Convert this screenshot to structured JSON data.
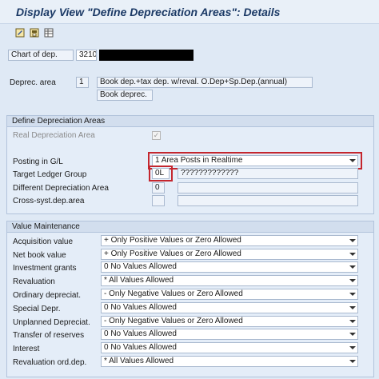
{
  "title": "Display View \"Define Depreciation Areas\": Details",
  "toolbar": {
    "icons": [
      "display-change-icon",
      "save-icon",
      "table-view-icon"
    ]
  },
  "header": {
    "chart_label": "Chart of dep.",
    "chart_value": "3210",
    "area_label": "Deprec. area",
    "area_value": "1",
    "area_description": "Book dep.+tax dep. w/reval. O.Dep+Sp.Dep.(annual)",
    "area_short": "Book deprec."
  },
  "define_areas": {
    "heading": "Define Depreciation Areas",
    "real_area_label": "Real Depreciation Area",
    "real_area_checked": true,
    "posting_label": "Posting in G/L",
    "posting_value": "1 Area Posts in Realtime",
    "target_label": "Target Ledger Group",
    "target_value": "0L",
    "target_desc": "?????????????",
    "diff_label": "Different Depreciation Area",
    "diff_value": "0",
    "cross_label": "Cross-syst.dep.area",
    "cross_value": ""
  },
  "value_maintenance": {
    "heading": "Value Maintenance",
    "rows": [
      {
        "label": "Acquisition value",
        "value": "+ Only Positive Values or Zero Allowed"
      },
      {
        "label": "Net book value",
        "value": "+ Only Positive Values or Zero Allowed"
      },
      {
        "label": "Investment grants",
        "value": "0 No Values Allowed"
      },
      {
        "label": "Revaluation",
        "value": "* All Values Allowed"
      },
      {
        "label": "Ordinary depreciat.",
        "value": "- Only Negative Values or Zero Allowed"
      },
      {
        "label": "Special Depr.",
        "value": "0 No Values Allowed"
      },
      {
        "label": "Unplanned Depreciat.",
        "value": "- Only Negative Values or Zero Allowed"
      },
      {
        "label": "Transfer of reserves",
        "value": "0 No Values Allowed"
      },
      {
        "label": "Interest",
        "value": "0 No Values Allowed"
      },
      {
        "label": "Revaluation ord.dep.",
        "value": "* All Values Allowed"
      }
    ]
  },
  "colors": {
    "highlight": "#c4262e",
    "title": "#1c3a66",
    "background": "#dfe9f5"
  }
}
